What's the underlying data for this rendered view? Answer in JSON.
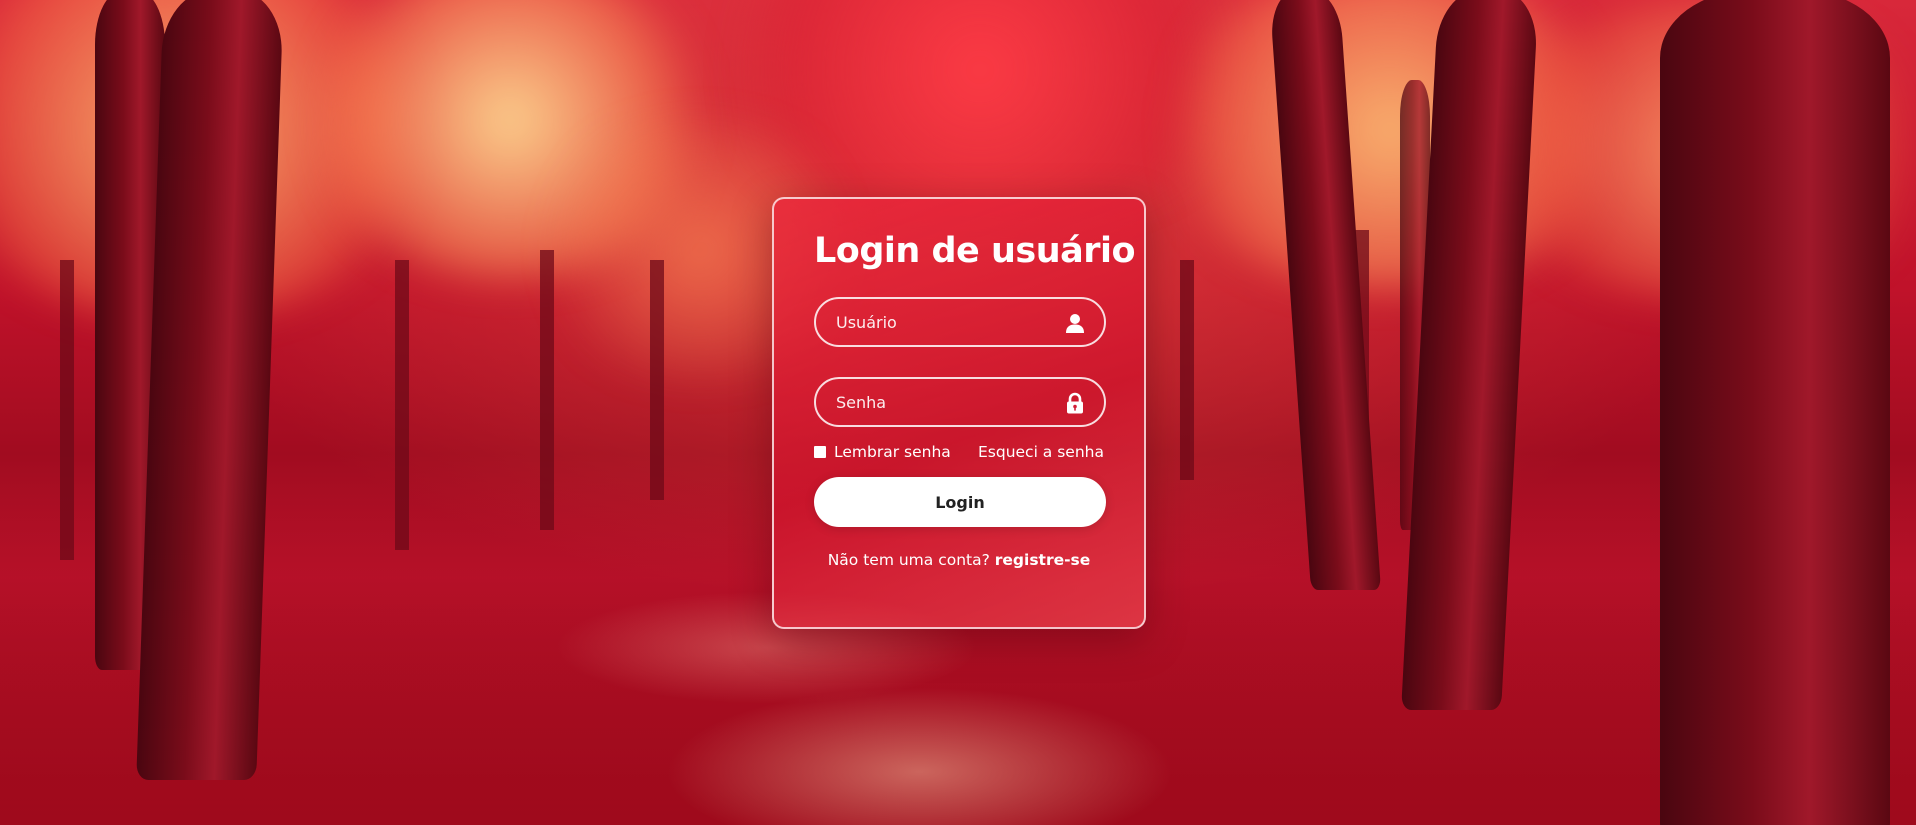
{
  "login": {
    "title": "Login de usuário",
    "username": {
      "placeholder": "Usuário",
      "value": "",
      "icon": "user-icon"
    },
    "password": {
      "placeholder": "Senha",
      "value": "",
      "icon": "lock-icon"
    },
    "remember_label": "Lembrar senha",
    "forgot_label": "Esqueci a senha",
    "submit_label": "Login",
    "register_prompt": "Não tem uma conta?",
    "register_link": "registre-se"
  },
  "colors": {
    "card_tint": "#e0283c",
    "button_bg": "#ffffff",
    "button_text": "#222222",
    "text": "#ffffff"
  }
}
